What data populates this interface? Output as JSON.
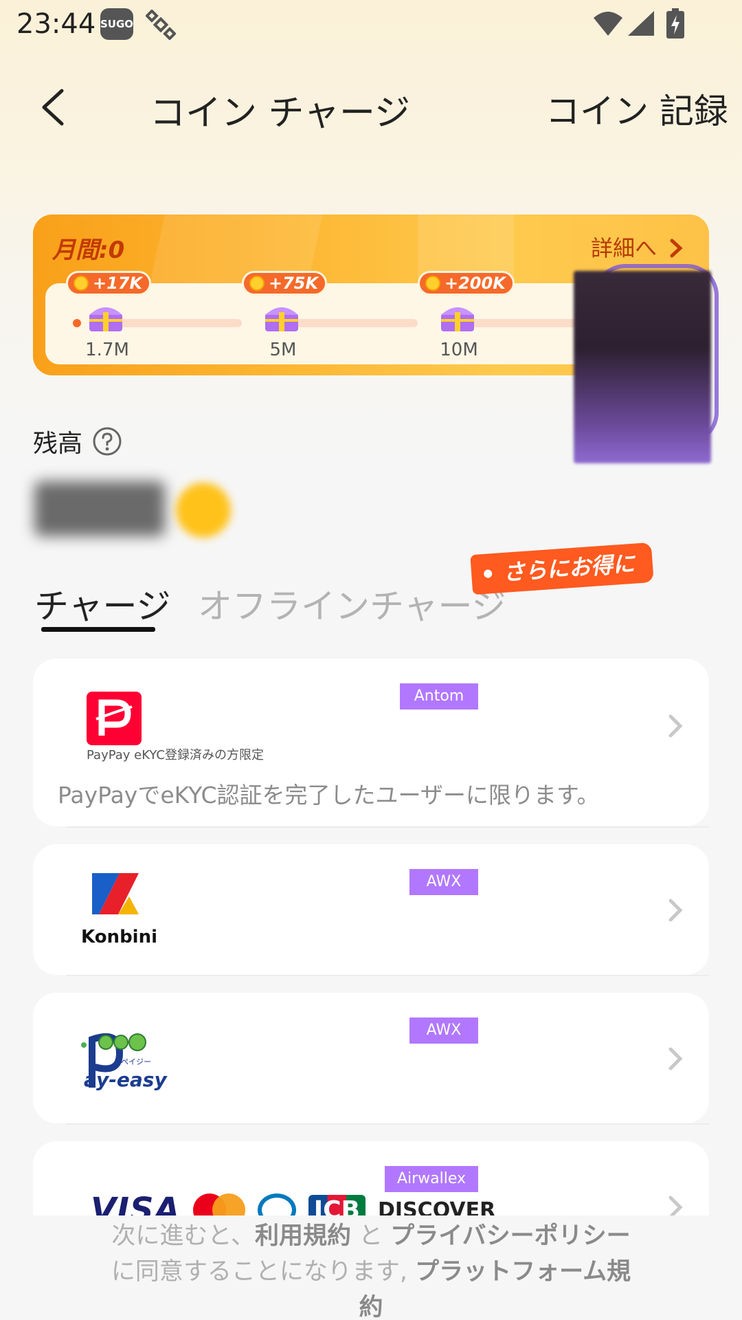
{
  "status_bar": {
    "time": "23:44",
    "app_icon_text": "SUGO",
    "icons": [
      "sugo-app-icon",
      "satellite-icon",
      "wifi-icon",
      "signal-icon",
      "battery-charging-icon"
    ]
  },
  "header": {
    "title": "コイン チャージ",
    "history_link": "コイン 記録",
    "back_icon": "chevron-left-icon"
  },
  "monthly": {
    "label": "月間:0",
    "detail_link": "詳細へ",
    "milestones": [
      {
        "reward": "+17K",
        "threshold": "1.7M"
      },
      {
        "reward": "+75K",
        "threshold": "5M"
      },
      {
        "reward": "+200K",
        "threshold": "10M"
      }
    ],
    "progress_fraction": 0
  },
  "balance": {
    "label": "残高",
    "value": "",
    "help_icon": "question-circle-icon"
  },
  "tabs": {
    "items": [
      {
        "label": "チャージ",
        "active": true
      },
      {
        "label": "オフラインチャージ",
        "active": false
      }
    ],
    "promo_tag": "さらにお得に"
  },
  "methods": [
    {
      "provider": "Antom",
      "logo": "paypay-logo",
      "logo_caption": "PayPay eKYC登録済みの方限定",
      "note": "PayPayでeKYC認証を完了したユーザーに限ります。"
    },
    {
      "provider": "AWX",
      "logo": "konbini-logo",
      "logo_text": "Konbini"
    },
    {
      "provider": "AWX",
      "logo": "payeasy-logo",
      "logo_text": "ay-easy",
      "logo_small": "ペイジー"
    },
    {
      "provider": "Airwallex",
      "logo": "card-brands-logo",
      "brands": [
        "VISA",
        "JCB",
        "DISCOVER"
      ]
    }
  ],
  "footer": {
    "prefix": "次に進むと、",
    "terms": "利用規約",
    "and": " と ",
    "privacy": "プライバシーポリシー",
    "middle": " に同意することになります, ",
    "platform_terms": "プラットフォーム規約"
  },
  "colors": {
    "accent_orange": "#ff5a1f",
    "badge_purple": "#b178ff",
    "paypay_red": "#ff0033"
  }
}
